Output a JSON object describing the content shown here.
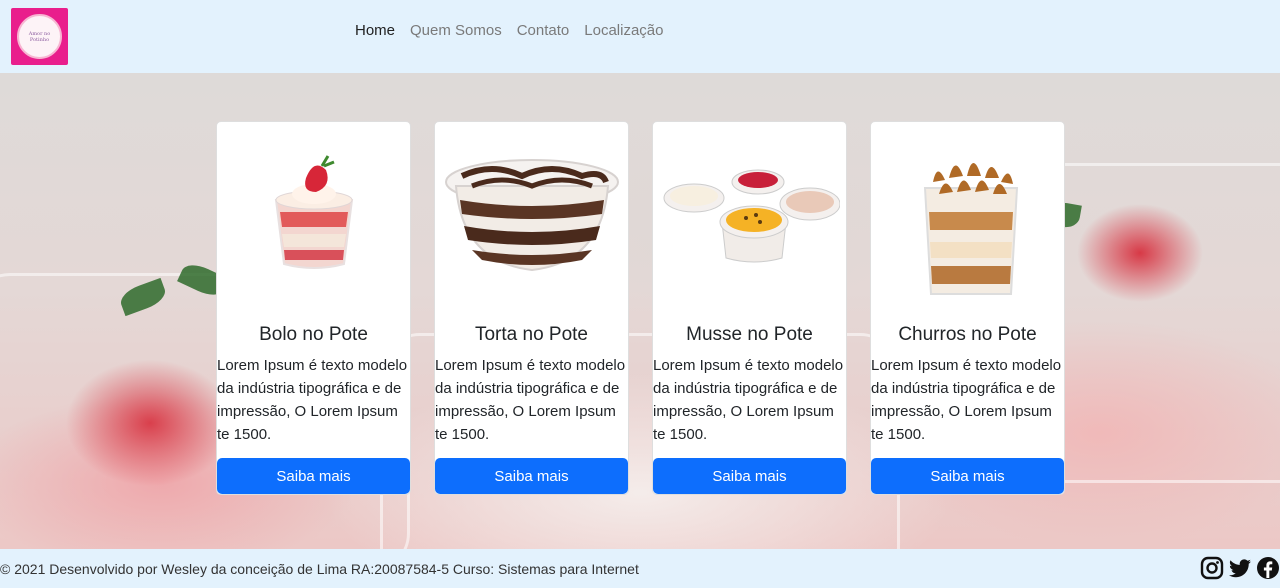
{
  "header": {
    "logo_text": "Amor no\nPotinho",
    "nav": [
      "Home",
      "Quem Somos",
      "Contato",
      "Localização"
    ]
  },
  "cards": [
    {
      "title": "Bolo no Pote",
      "text": "Lorem Ipsum é texto modelo da indústria tipográfica e de impressão, O Lorem Ipsum te 1500.",
      "button": "Saiba mais"
    },
    {
      "title": "Torta no Pote",
      "text": "Lorem Ipsum é texto modelo da indústria tipográfica e de impressão, O Lorem Ipsum te 1500.",
      "button": "Saiba mais"
    },
    {
      "title": "Musse no Pote",
      "text": "Lorem Ipsum é texto modelo da indústria tipográfica e de impressão, O Lorem Ipsum te 1500.",
      "button": "Saiba mais"
    },
    {
      "title": "Churros no Pote",
      "text": "Lorem Ipsum é texto modelo da indústria tipográfica e de impressão, O Lorem Ipsum te 1500.",
      "button": "Saiba mais"
    }
  ],
  "footer": {
    "text": "© 2021 Desenvolvido por Wesley da conceição de Lima RA:20087584-5 Curso: Sistemas para Internet",
    "social_icons": [
      "instagram-icon",
      "twitter-icon",
      "facebook-icon"
    ]
  },
  "colors": {
    "navbar_bg": "#e3f2fd",
    "button_primary": "#0d6efd",
    "logo_bg": "#e91e8c"
  }
}
